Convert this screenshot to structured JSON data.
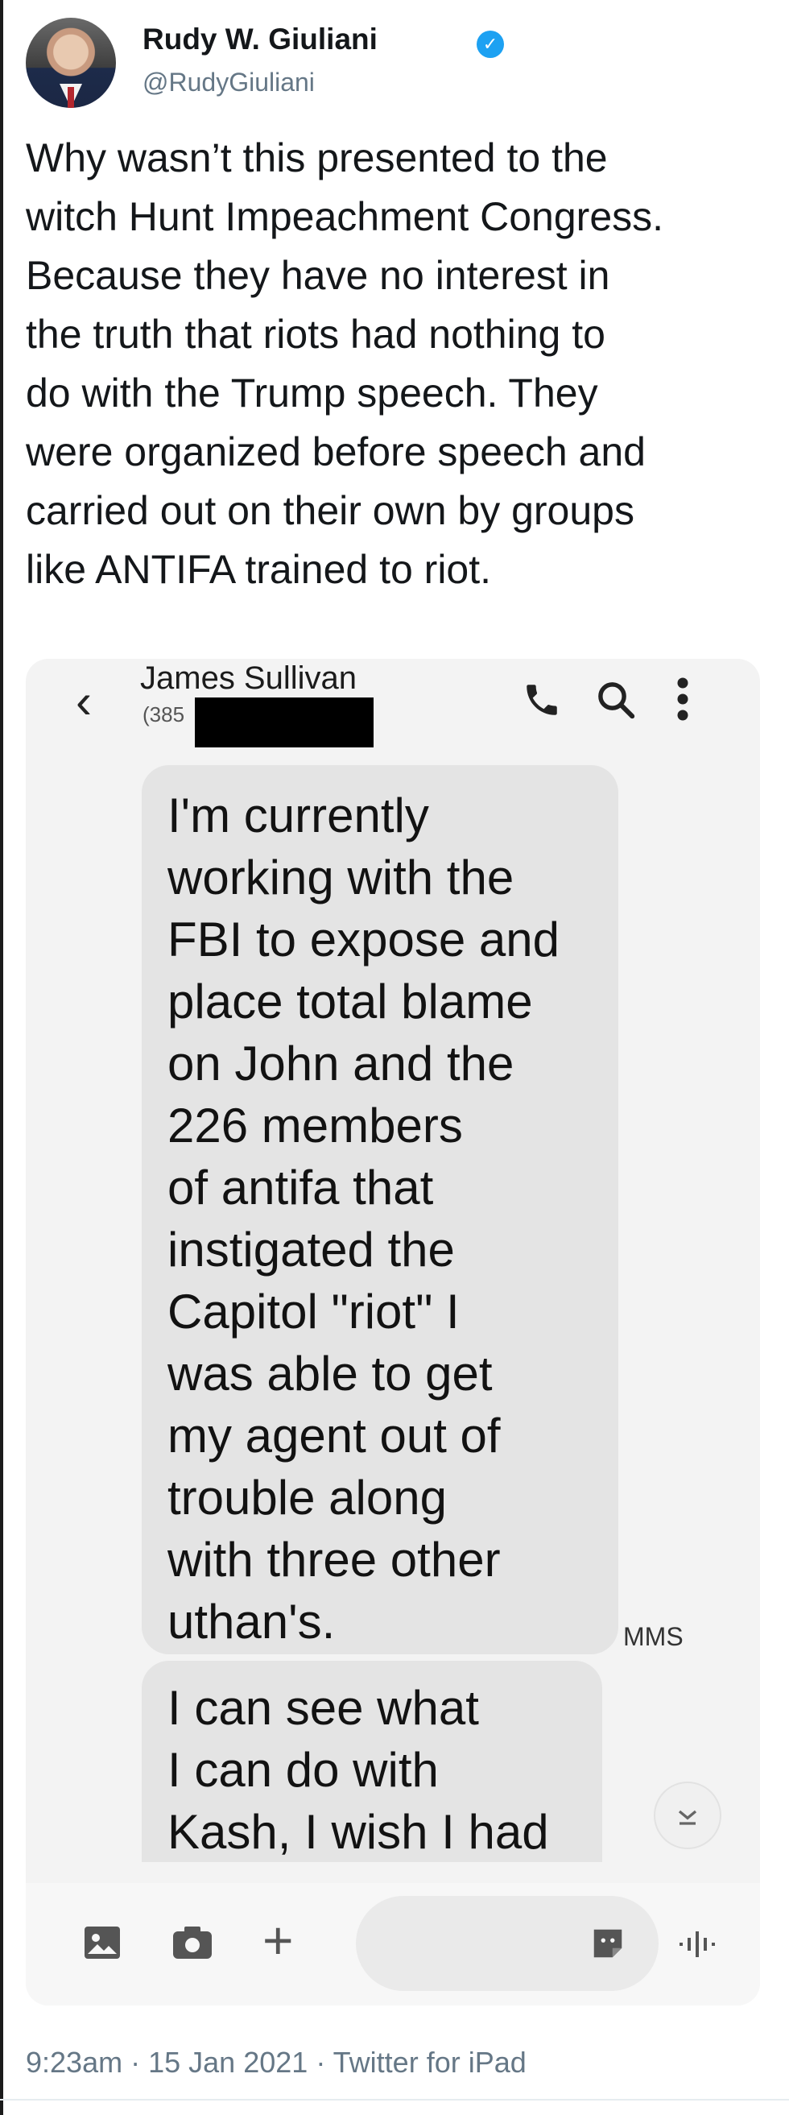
{
  "tweet": {
    "author_name": "Rudy W. Giuliani",
    "author_handle": "@RudyGiuliani",
    "text": "Why wasn’t this presented to the\nwitch Hunt Impeachment Congress.\nBecause they have no interest in\nthe truth that riots had nothing to\ndo with the Trump speech. They\nwere organized before speech and\ncarried out on their own by groups\nlike ANTIFA trained to riot.",
    "time": "9:23am",
    "date": "15 Jan 2021",
    "source": "Twitter for iPad",
    "separator": "·"
  },
  "screenshot": {
    "contact_name": "James Sullivan",
    "contact_number_visible": "(385",
    "messages": [
      {
        "text": "I'm currently\nworking with the\nFBI to expose and\nplace total blame\non John and the\n226 members\nof antifa that\ninstigated the\nCapitol \"riot\" I\nwas able to get\nmy agent out of\ntrouble along\nwith three other\nuthan's."
      },
      {
        "text": "I can see what\nI can do with\nKash, I wish I had"
      }
    ],
    "mms_label": "MMS"
  },
  "colors": {
    "verified": "#1da1f2",
    "handle": "#657786",
    "bubble": "#e4e4e4"
  }
}
